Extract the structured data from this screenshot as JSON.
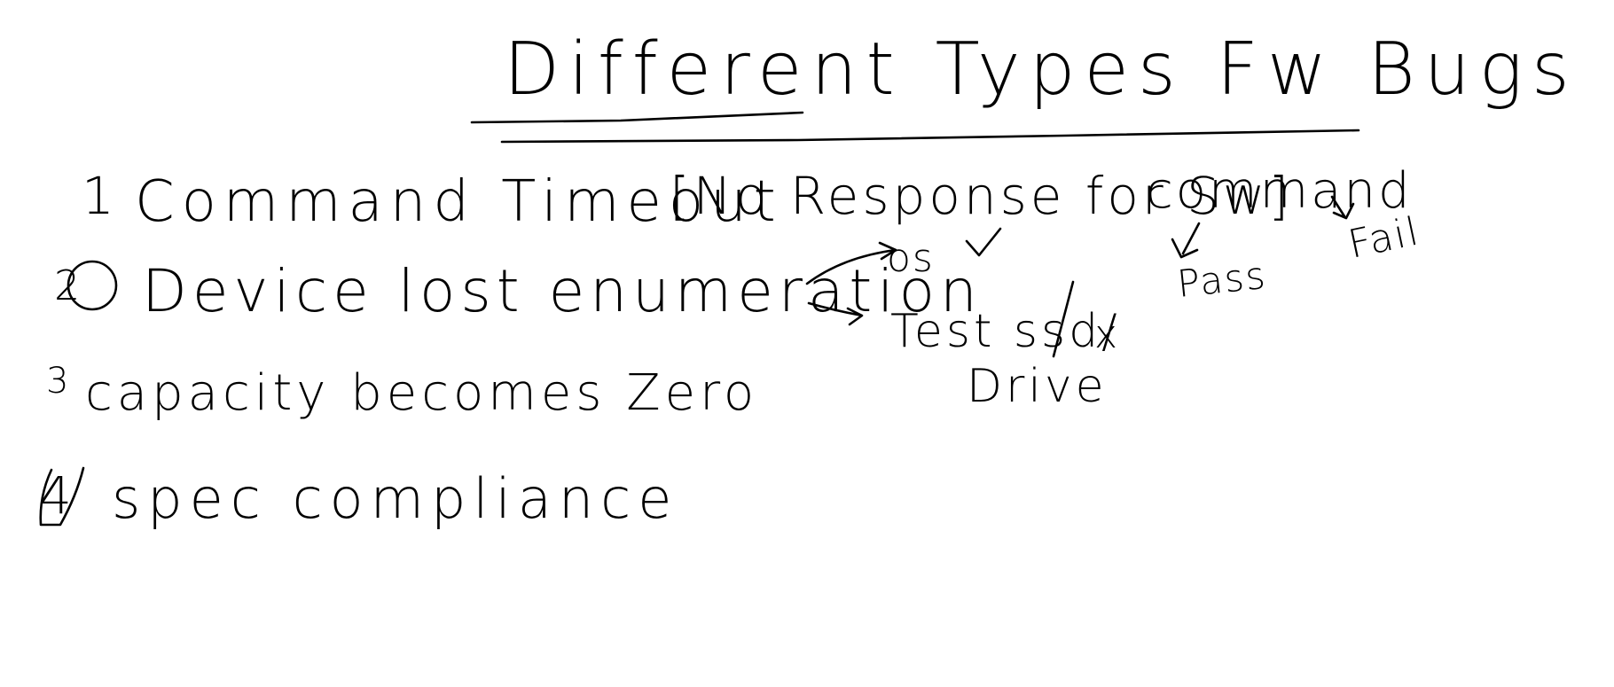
{
  "title": "Different Types Fw Bugs",
  "items": [
    {
      "number": "1",
      "text": "Command Timeout",
      "note": "[No Response for Sw]",
      "extra": "command"
    },
    {
      "number": "2",
      "text": "Device lost enumeration"
    },
    {
      "number": "3",
      "text": "capacity becomes Zero"
    },
    {
      "number": "4",
      "text": "spec compliance"
    }
  ],
  "branches": {
    "os": "os",
    "tool": "Test ssd/",
    "drive": "Drive",
    "mark_x": "x",
    "pass": "Pass",
    "fail": "Fail"
  }
}
